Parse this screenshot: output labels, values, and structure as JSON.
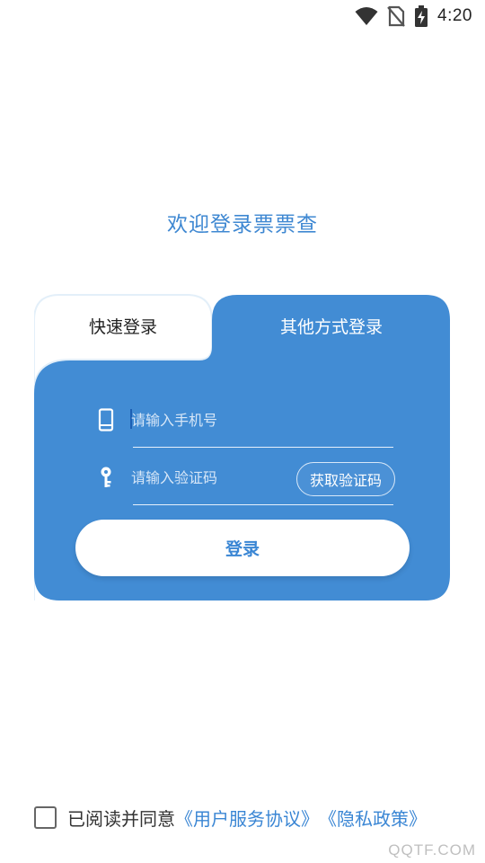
{
  "status_bar": {
    "time": "4:20",
    "icons": [
      "wifi-icon",
      "no-sim-icon",
      "battery-charging-icon"
    ]
  },
  "welcome_text": "欢迎登录票票查",
  "tabs": {
    "quick_login": "快速登录",
    "other_login": "其他方式登录"
  },
  "form": {
    "phone_placeholder": "请输入手机号",
    "code_placeholder": "请输入验证码",
    "get_code_label": "获取验证码",
    "login_label": "登录"
  },
  "agreement": {
    "prefix": "已阅读并同意",
    "user_agreement": "《用户服务协议》",
    "privacy_policy": "《隐私政策》"
  },
  "watermark": "QQTF.COM",
  "colors": {
    "accent": "#428cd4",
    "card_background": "#428cd4",
    "link": "#3a86d4"
  }
}
